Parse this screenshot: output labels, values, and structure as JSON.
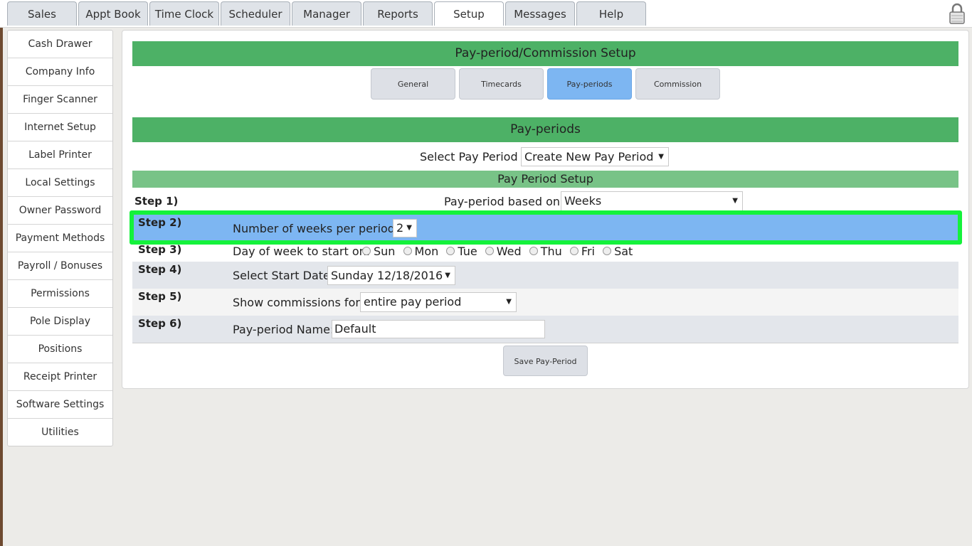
{
  "top_tabs": [
    "Sales",
    "Appt Book",
    "Time Clock",
    "Scheduler",
    "Manager",
    "Reports",
    "Setup",
    "Messages",
    "Help"
  ],
  "sidebar_items": [
    "Cash Drawer",
    "Company Info",
    "Finger Scanner",
    "Internet Setup",
    "Label Printer",
    "Local Settings",
    "Owner Password",
    "Payment Methods",
    "Payroll / Bonuses",
    "Permissions",
    "Pole Display",
    "Positions",
    "Receipt Printer",
    "Software Settings",
    "Utilities"
  ],
  "main": {
    "title": "Pay-period/Commission Setup",
    "subtabs": [
      "General",
      "Timecards",
      "Pay-periods",
      "Commission"
    ],
    "section_title": "Pay-periods",
    "select_pay_period_label": "Select Pay Period :",
    "select_pay_period_value": "Create New Pay Period",
    "setup_title": "Pay Period Setup",
    "steps": {
      "s1": {
        "step": "Step 1)",
        "label": "Pay-period based on:",
        "value": "Weeks"
      },
      "s2": {
        "step": "Step 2)",
        "label": "Number of weeks per period:",
        "value": "2"
      },
      "s3": {
        "step": "Step 3)",
        "label": "Day of week to start on:",
        "days": [
          "Sun",
          "Mon",
          "Tue",
          "Wed",
          "Thu",
          "Fri",
          "Sat"
        ]
      },
      "s4": {
        "step": "Step 4)",
        "label": "Select Start Date:",
        "value": "Sunday 12/18/2016"
      },
      "s5": {
        "step": "Step 5)",
        "label": "Show commissions for:",
        "value": "entire pay period"
      },
      "s6": {
        "step": "Step 6)",
        "label": "Pay-period Name:",
        "value": "Default"
      }
    },
    "save_button": "Save Pay-Period"
  },
  "colors": {
    "green": "#4db166",
    "light_green": "#78c387",
    "highlight_blue": "#7db6f2",
    "highlight_border": "#14f23b"
  }
}
